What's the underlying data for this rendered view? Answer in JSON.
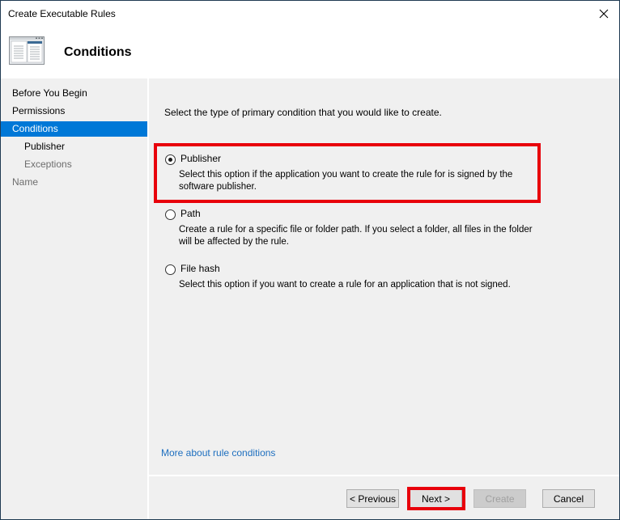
{
  "window": {
    "title": "Create Executable Rules",
    "close_icon": "close-icon"
  },
  "header": {
    "icon": "wizard-window-icon",
    "title": "Conditions"
  },
  "sidebar": {
    "items": [
      {
        "label": "Before You Begin",
        "state": "normal"
      },
      {
        "label": "Permissions",
        "state": "normal"
      },
      {
        "label": "Conditions",
        "state": "active"
      },
      {
        "label": "Publisher",
        "state": "sub"
      },
      {
        "label": "Exceptions",
        "state": "sub-disabled"
      },
      {
        "label": "Name",
        "state": "disabled"
      }
    ]
  },
  "main": {
    "intro": "Select the type of primary condition that you would like to create.",
    "options": [
      {
        "label": "Publisher",
        "description": "Select this option if the application you want to create the rule for is signed by the software publisher.",
        "checked": true
      },
      {
        "label": "Path",
        "description": "Create a rule for a specific file or folder path. If you select a folder, all files in the folder will be affected by the rule.",
        "checked": false
      },
      {
        "label": "File hash",
        "description": "Select this option if you want to create a rule for an application that is not signed.",
        "checked": false
      }
    ],
    "link": "More about rule conditions"
  },
  "footer": {
    "previous": "< Previous",
    "next": "Next >",
    "create": "Create",
    "cancel": "Cancel"
  },
  "colors": {
    "accent": "#0078d7",
    "highlight": "#e8000b",
    "link": "#1e6fbf"
  }
}
